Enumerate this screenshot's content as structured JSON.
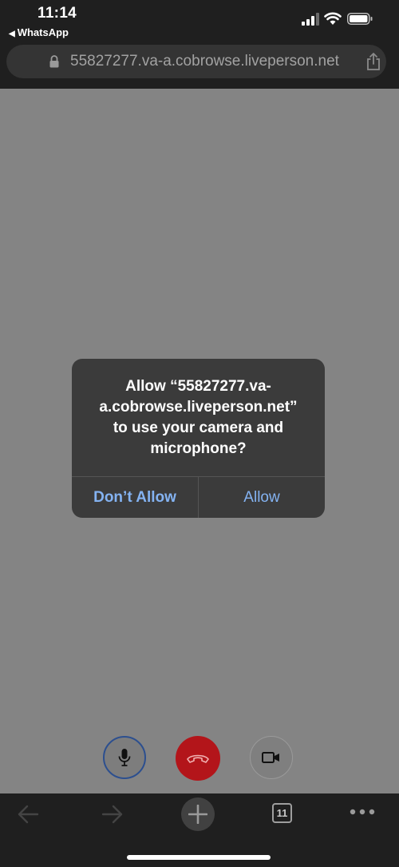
{
  "status_bar": {
    "time": "11:14",
    "back_app": "WhatsApp",
    "back_icon": "back-triangle-icon",
    "icons": [
      "cellular-signal-icon",
      "wifi-icon",
      "battery-icon"
    ]
  },
  "address_bar": {
    "url": "55827277.va-a.cobrowse.liveperson.net",
    "lock_icon": "lock-icon",
    "share_icon": "share-icon"
  },
  "dialog": {
    "message": "Allow “55827277.va-a.cobrowse.liveperson.net” to use your camera and microphone?",
    "message_lines": [
      "Allow “55827277.va-",
      "a.cobrowse.liveperson.net”",
      "to use your camera and",
      "microphone?"
    ],
    "deny_label": "Don’t Allow",
    "allow_label": "Allow",
    "button_color": "#84b3f2"
  },
  "call_controls": {
    "items": [
      "microphone-icon",
      "hang-up-icon",
      "video-camera-icon"
    ],
    "hangup_color": "#b3151a"
  },
  "toolbar": {
    "tab_count": "11",
    "icons": [
      "back-arrow-icon",
      "forward-arrow-icon",
      "new-tab-plus-icon",
      "tabs-icon",
      "more-icon"
    ]
  }
}
